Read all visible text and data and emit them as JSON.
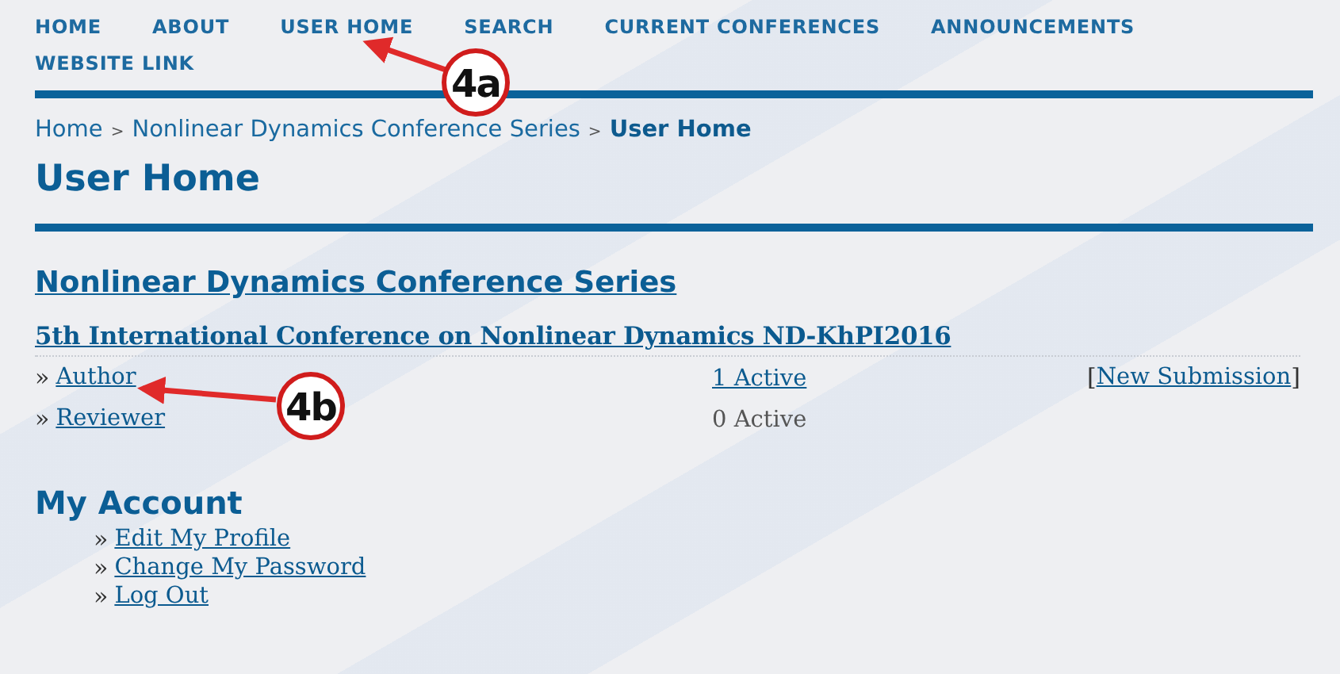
{
  "nav": [
    {
      "label": "HOME"
    },
    {
      "label": "ABOUT"
    },
    {
      "label": "USER HOME"
    },
    {
      "label": "SEARCH"
    },
    {
      "label": "CURRENT CONFERENCES"
    },
    {
      "label": "ANNOUNCEMENTS"
    },
    {
      "label": "WEBSITE LINK"
    }
  ],
  "breadcrumb": [
    {
      "label": "Home",
      "current": false
    },
    {
      "separator": ">"
    },
    {
      "label": "Nonlinear Dynamics Conference Series",
      "current": false
    },
    {
      "separator": ">"
    },
    {
      "label": "User Home",
      "current": true
    }
  ],
  "page_title": "User Home",
  "journal_title": "Nonlinear Dynamics Conference Series",
  "conference_title": "5th International Conference on Nonlinear Dynamics ND-KhPI2016",
  "roles": [
    {
      "prefix": "»",
      "label": "Author",
      "count": "1 Active",
      "count_is_link": true,
      "action": {
        "open": "[",
        "label": "New Submission",
        "close": "]"
      }
    },
    {
      "prefix": "»",
      "label": "Reviewer",
      "count": "0 Active",
      "count_is_link": false
    }
  ],
  "account": {
    "title": "My Account",
    "links": [
      {
        "prefix": "»",
        "label": "Edit My Profile"
      },
      {
        "prefix": "»",
        "label": "Change My Password"
      },
      {
        "prefix": "»",
        "label": "Log Out"
      }
    ]
  },
  "callouts": [
    {
      "label": "4a"
    },
    {
      "label": "4b"
    }
  ]
}
